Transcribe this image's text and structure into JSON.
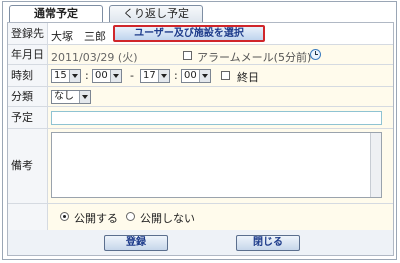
{
  "tabs": [
    {
      "label": "通常予定",
      "active": true
    },
    {
      "label": "くり返し予定",
      "active": false
    }
  ],
  "form": {
    "registrant": {
      "label": "登録先",
      "value": "大塚　三郎",
      "select_button": "ユーザー及び施設を選択"
    },
    "date": {
      "label": "年月日",
      "value": "2011/03/29 (火)",
      "alarm_label": "アラームメール(5分前)",
      "alarm_checked": false
    },
    "time": {
      "label": "時刻",
      "start_hour": "15",
      "start_min": "00",
      "sep_colon": ":",
      "sep_dash": "-",
      "end_hour": "17",
      "end_min": "00",
      "allday_label": "終日",
      "allday_checked": false
    },
    "category": {
      "label": "分類",
      "value": "なし"
    },
    "title": {
      "label": "予定",
      "value": ""
    },
    "notes": {
      "label": "備考",
      "value": ""
    },
    "visibility": {
      "public_label": "公開する",
      "private_label": "公開しない",
      "selected": "public"
    }
  },
  "footer": {
    "register_label": "登録",
    "close_label": "閉じる"
  }
}
